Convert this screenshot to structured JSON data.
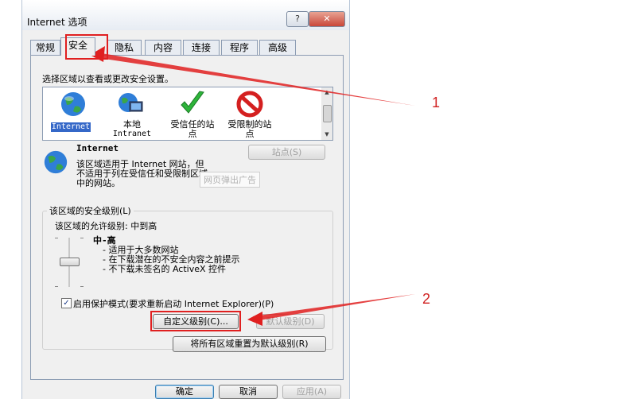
{
  "window": {
    "title": "Internet 选项",
    "help_label": "?",
    "close_label": "✕"
  },
  "tabs": [
    "常规",
    "安全",
    "隐私",
    "内容",
    "连接",
    "程序",
    "高级"
  ],
  "security": {
    "instruction": "选择区域以查看或更改安全设置。",
    "zones": [
      {
        "line1": "Internet",
        "line2": "",
        "icon": "globe-icon"
      },
      {
        "line1": "本地",
        "line2": "Intranet",
        "icon": "intranet-icon"
      },
      {
        "line1": "受信任的站",
        "line2": "点",
        "icon": "check-icon"
      },
      {
        "line1": "受限制的站",
        "line2": "点",
        "icon": "restricted-icon"
      }
    ],
    "sites_button": "站点(S)",
    "zone_title": "Internet",
    "zone_desc": [
      "该区域适用于 Internet 网站，但",
      "不适用于列在受信任和受限制区域",
      "中的网站。"
    ],
    "tooltip": "网页弹出广告",
    "group_label": "该区域的安全级别(L)",
    "allowed_levels": "该区域的允许级别: 中到高",
    "level_name": "中-高",
    "level_points": [
      "- 适用于大多数网站",
      "- 在下载潜在的不安全内容之前提示",
      "- 不下载未签名的 ActiveX 控件"
    ],
    "protected_mode": "启用保护模式(要求重新启动 Internet Explorer)(P)",
    "custom_level_button": "自定义级别(C)...",
    "default_level_button": "默认级别(D)",
    "reset_all_button": "将所有区域重置为默认级别(R)"
  },
  "footer": {
    "ok": "确定",
    "cancel": "取消",
    "apply": "应用(A)"
  },
  "annotations": {
    "label1": "1",
    "label2": "2"
  },
  "colors": {
    "highlight": "#e02020",
    "selection": "#3568c8"
  }
}
